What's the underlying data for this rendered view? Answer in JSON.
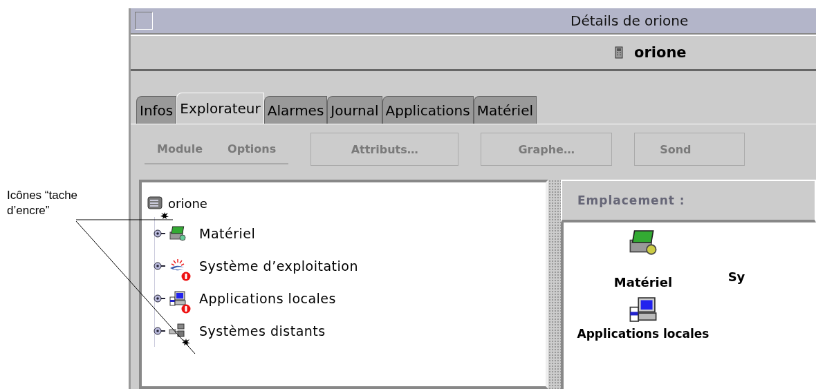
{
  "annotation": {
    "label": "Icônes “tache d’encre”"
  },
  "window": {
    "title": "Détails de orione",
    "host": "orione"
  },
  "tabs": [
    {
      "label": "Infos",
      "selected": false
    },
    {
      "label": "Explorateur",
      "selected": true
    },
    {
      "label": "Alarmes",
      "selected": false
    },
    {
      "label": "Journal",
      "selected": false
    },
    {
      "label": "Applications",
      "selected": false
    },
    {
      "label": "Matériel",
      "selected": false
    }
  ],
  "menus": [
    {
      "label": "Module",
      "disabled": true
    },
    {
      "label": "Options",
      "disabled": true
    }
  ],
  "buttons": [
    {
      "label": "Attributs…",
      "disabled": true
    },
    {
      "label": "Graphe…",
      "disabled": true
    },
    {
      "label": "Sond",
      "disabled": true
    }
  ],
  "tree": {
    "label": "orione",
    "ink_spot": true,
    "children": [
      {
        "label": "Matériel",
        "kind": "hardware",
        "alarm": false,
        "ink_spot": false
      },
      {
        "label": "Système d’exploitation",
        "kind": "os",
        "alarm": true,
        "ink_spot": false
      },
      {
        "label": "Applications locales",
        "kind": "apps",
        "alarm": true,
        "ink_spot": false
      },
      {
        "label": "Systèmes distants",
        "kind": "remote",
        "alarm": false,
        "ink_spot": true
      }
    ]
  },
  "location": {
    "label": "Emplacement :"
  },
  "content_items": [
    {
      "label": "Matériel",
      "kind": "hardware"
    },
    {
      "label": "Sy",
      "kind": "none"
    },
    {
      "label": "Applications locales",
      "kind": "apps"
    }
  ]
}
